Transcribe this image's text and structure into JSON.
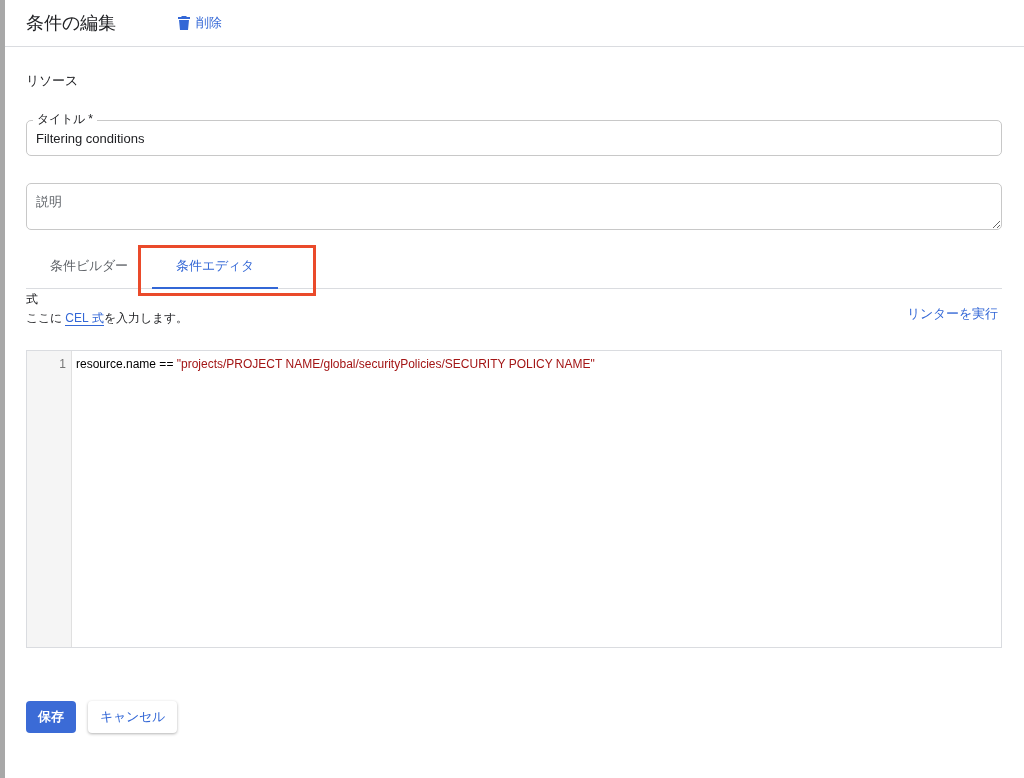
{
  "header": {
    "title": "条件の編集",
    "delete_label": "削除"
  },
  "section_label": "リソース",
  "title_field": {
    "label": "タイトル *",
    "value": "Filtering conditions"
  },
  "description_field": {
    "placeholder": "説明"
  },
  "tabs": [
    {
      "label": "条件ビルダー",
      "selected": false,
      "highlighted": false
    },
    {
      "label": "条件エディタ",
      "selected": true,
      "highlighted": true
    }
  ],
  "expression": {
    "label": "式",
    "help_before": "ここに ",
    "help_link": "CEL 式",
    "help_after": "を入力します。",
    "linter_link": "リンターを実行"
  },
  "editor": {
    "lines": [
      {
        "number": "1",
        "tokens": [
          {
            "kind": "plain",
            "text": "resource.name == "
          },
          {
            "kind": "string",
            "text": "\"projects/PROJECT NAME/global/securityPolicies/SECURITY POLICY NAME\""
          }
        ]
      }
    ]
  },
  "buttons": [
    {
      "label": "保存",
      "kind": "primary"
    },
    {
      "label": "キャンセル",
      "kind": "secondary"
    }
  ]
}
